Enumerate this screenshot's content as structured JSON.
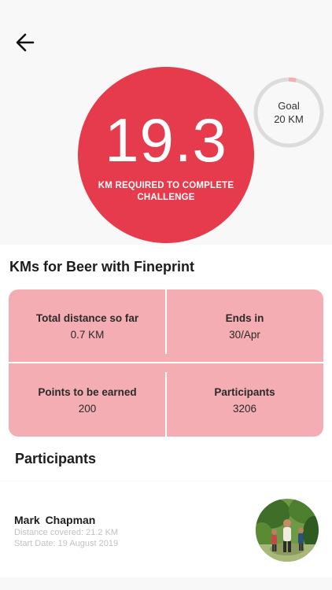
{
  "header": {
    "back_icon": "arrow-left-icon"
  },
  "progress": {
    "remaining_km": "19.3",
    "caption": "KM REQUIRED TO COMPLETE CHALLENGE",
    "color": "#e63b4c"
  },
  "goal": {
    "label": "Goal",
    "value": "20 KM",
    "completed_fraction": 0.035,
    "ring_color": "#dcdcdc",
    "progress_color": "#f4adb2"
  },
  "challenge": {
    "title": "KMs for Beer with Fineprint",
    "stats_bg_color": "#f4adb2",
    "stats": [
      {
        "label": "Total distance so far",
        "value": "0.7 KM"
      },
      {
        "label": "Ends in",
        "value": "30/Apr"
      },
      {
        "label": "Points to be earned",
        "value": "200"
      },
      {
        "label": "Participants",
        "value": "3206"
      }
    ]
  },
  "participants": {
    "heading": "Participants",
    "items": [
      {
        "name": "Mark  Chapman",
        "distance": "Distance covered: 21.2 KM",
        "start_date": "Start Date: 19 August 2019"
      }
    ]
  }
}
